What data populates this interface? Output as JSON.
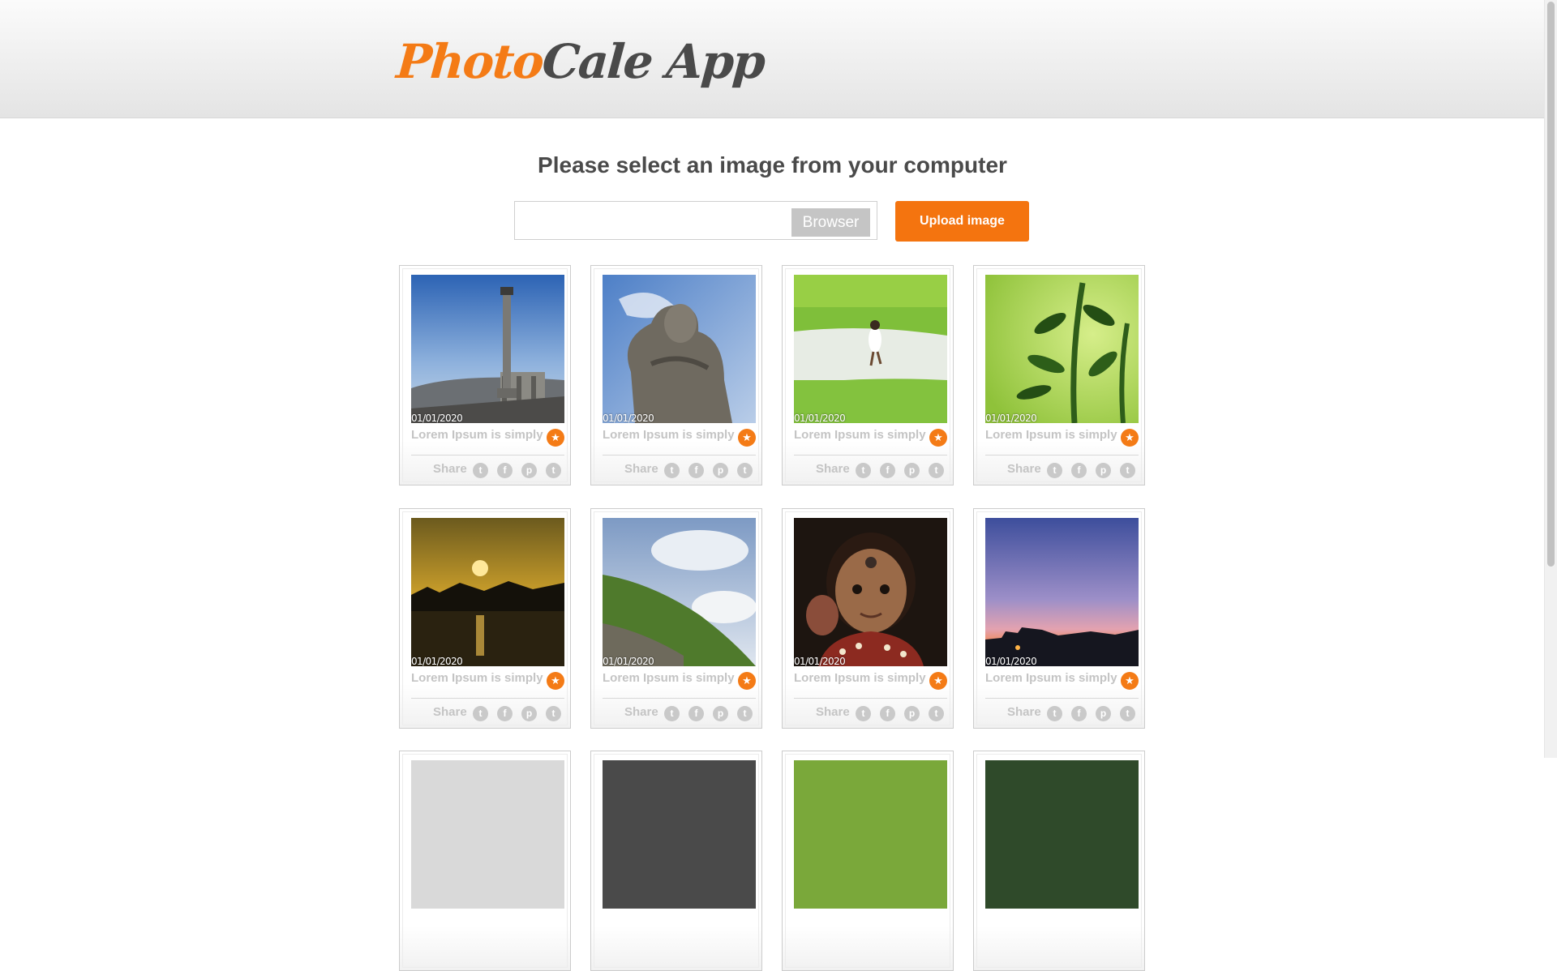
{
  "app": {
    "logo_part1": "Photo",
    "logo_part2": "Cale App"
  },
  "upload": {
    "prompt": "Please select an image from your computer",
    "file_value": "",
    "browse_label": "Browser",
    "upload_label": "Upload image"
  },
  "colors": {
    "accent": "#f47b16",
    "text_dark": "#4a4a4a",
    "muted": "#c4c4c4"
  },
  "photos": [
    {
      "date": "01/01/2020",
      "caption": "Lorem Ipsum is simply",
      "share_label": "Share",
      "subject": "stone pillar under blue sky"
    },
    {
      "date": "01/01/2020",
      "caption": "Lorem Ipsum is simply",
      "share_label": "Share",
      "subject": "stone statue against sky"
    },
    {
      "date": "01/01/2020",
      "caption": "Lorem Ipsum is simply",
      "share_label": "Share",
      "subject": "child walking in green field"
    },
    {
      "date": "01/01/2020",
      "caption": "Lorem Ipsum is simply",
      "share_label": "Share",
      "subject": "green plant leaves"
    },
    {
      "date": "01/01/2020",
      "caption": "Lorem Ipsum is simply",
      "share_label": "Share",
      "subject": "sunset over water"
    },
    {
      "date": "01/01/2020",
      "caption": "Lorem Ipsum is simply",
      "share_label": "Share",
      "subject": "green hill with clouds"
    },
    {
      "date": "01/01/2020",
      "caption": "Lorem Ipsum is simply",
      "share_label": "Share",
      "subject": "portrait of a young child"
    },
    {
      "date": "01/01/2020",
      "caption": "Lorem Ipsum is simply",
      "share_label": "Share",
      "subject": "city skyline at dusk"
    },
    {
      "date": "",
      "caption": "",
      "share_label": "",
      "subject": "partially visible photo"
    },
    {
      "date": "",
      "caption": "",
      "share_label": "",
      "subject": "partially visible photo"
    },
    {
      "date": "",
      "caption": "",
      "share_label": "",
      "subject": "partially visible photo"
    },
    {
      "date": "",
      "caption": "",
      "share_label": "",
      "subject": "partially visible photo"
    }
  ],
  "share_icons": [
    {
      "icon": "twitter-icon",
      "glyph": "t"
    },
    {
      "icon": "facebook-icon",
      "glyph": "f"
    },
    {
      "icon": "pinterest-icon",
      "glyph": "p"
    },
    {
      "icon": "tumblr-icon",
      "glyph": "t"
    }
  ],
  "favorite_icon": {
    "icon": "star-icon",
    "glyph": "★"
  }
}
